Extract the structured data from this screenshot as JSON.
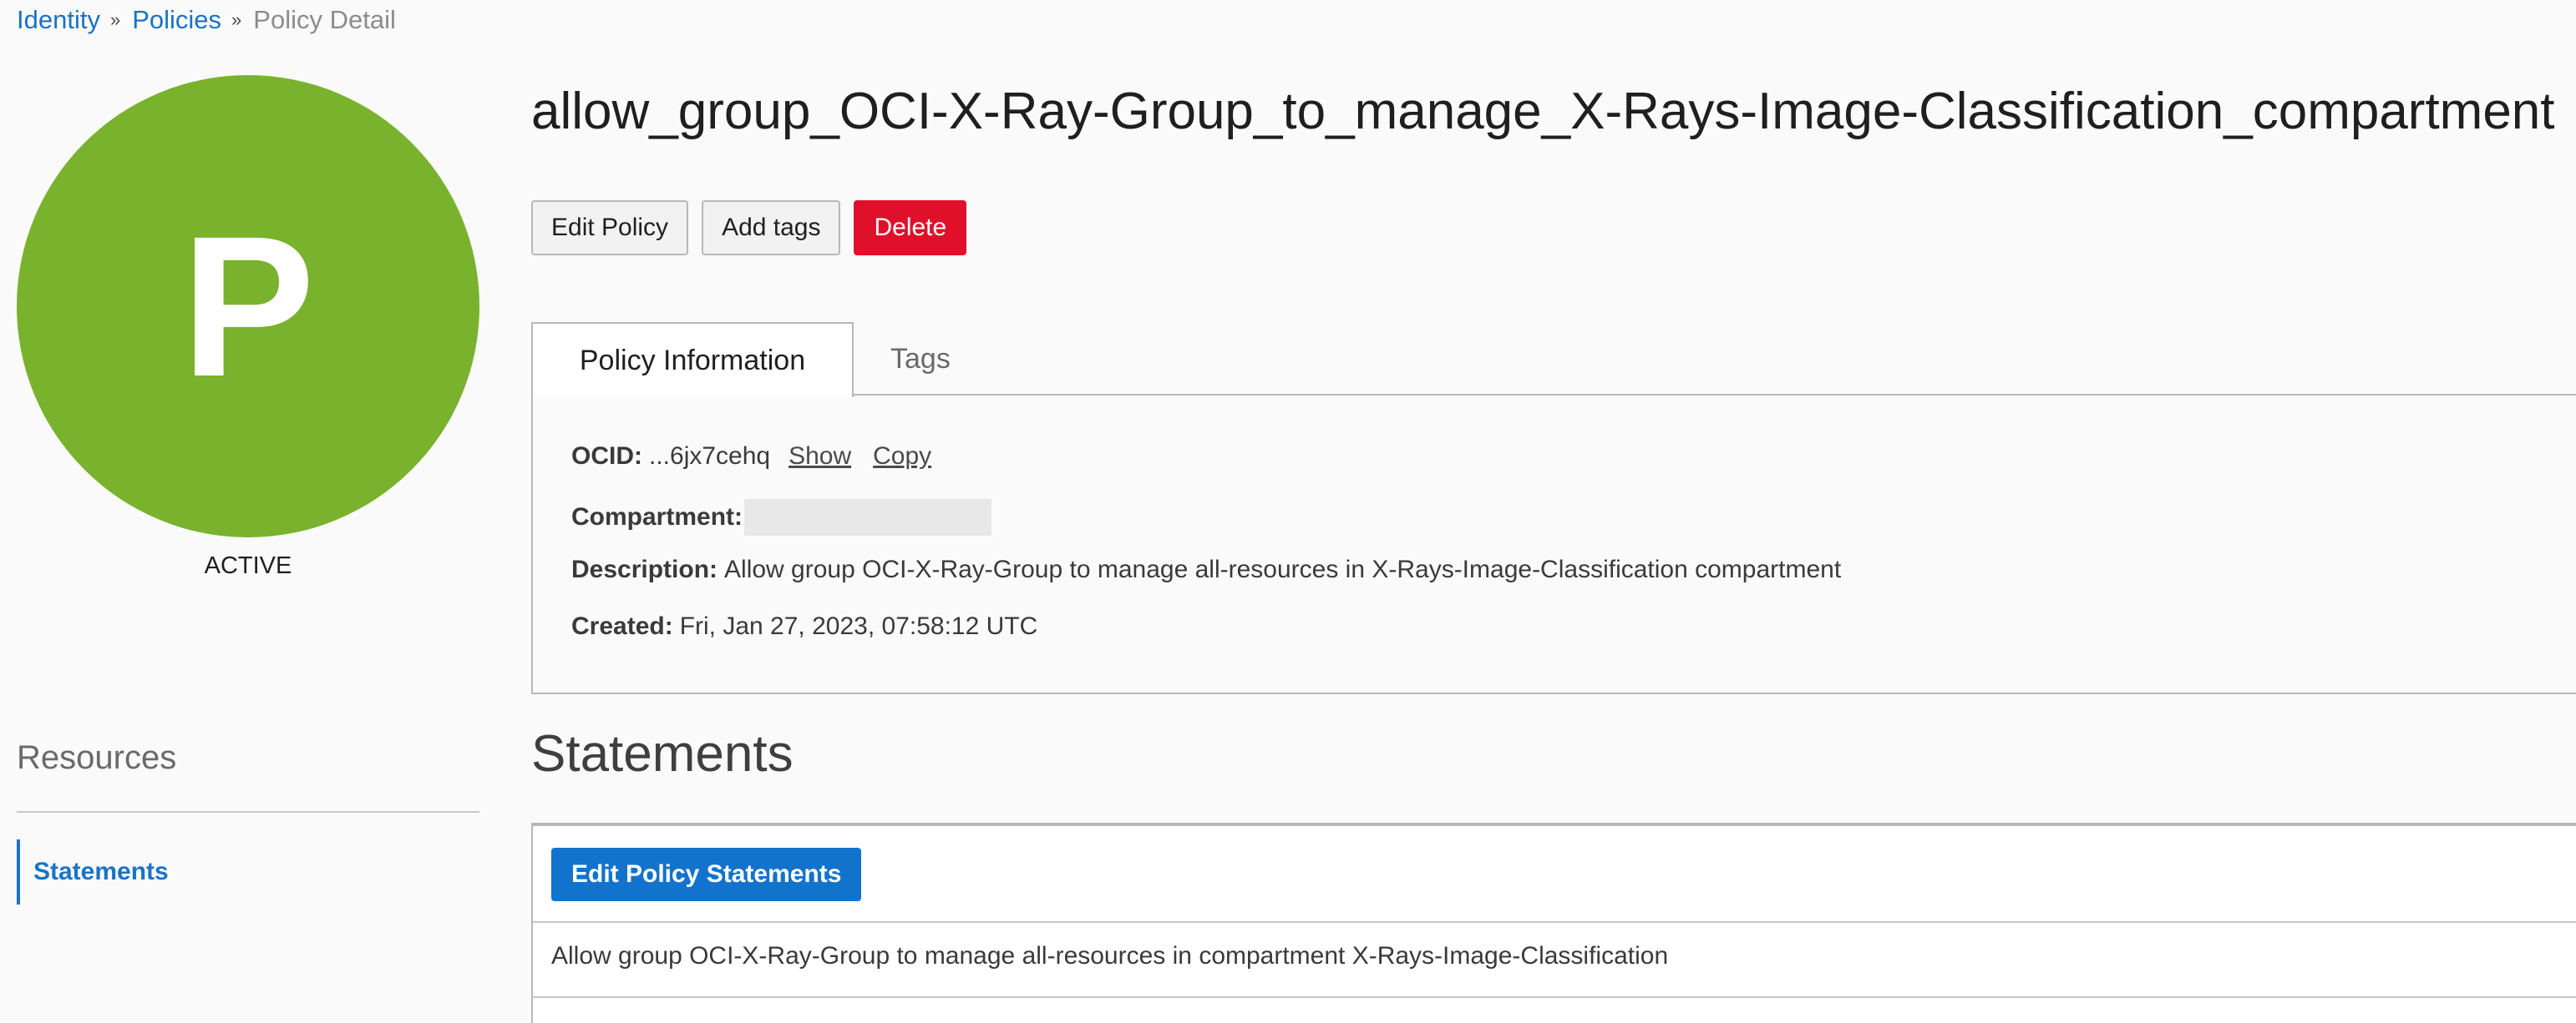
{
  "breadcrumb": {
    "items": [
      {
        "label": "Identity"
      },
      {
        "label": "Policies"
      }
    ],
    "current": "Policy Detail"
  },
  "avatar": {
    "letter": "P",
    "color": "#79b22d"
  },
  "status": "ACTIVE",
  "sidebar": {
    "heading": "Resources",
    "items": [
      {
        "label": "Statements",
        "active": true
      }
    ]
  },
  "title": "allow_group_OCI-X-Ray-Group_to_manage_X-Rays-Image-Classification_compartment",
  "actions": {
    "edit": "Edit Policy",
    "tags": "Add tags",
    "delete": "Delete"
  },
  "tabs": [
    {
      "label": "Policy Information",
      "active": true
    },
    {
      "label": "Tags",
      "active": false
    }
  ],
  "info": {
    "ocid_label": "OCID:",
    "ocid_value": "...6jx7cehq",
    "show": "Show",
    "copy": "Copy",
    "compartment_label": "Compartment:",
    "compartment_value": "",
    "description_label": "Description:",
    "description_value": "Allow group OCI-X-Ray-Group to manage all-resources in X-Rays-Image-Classification compartment",
    "created_label": "Created:",
    "created_value": "Fri, Jan 27, 2023, 07:58:12 UTC"
  },
  "statements": {
    "heading": "Statements",
    "edit_button": "Edit Policy Statements",
    "rows": [
      "Allow group OCI-X-Ray-Group to manage all-resources in compartment X-Rays-Image-Classification"
    ]
  },
  "colors": {
    "link": "#1a73c5",
    "delete": "#e0102a",
    "primary": "#1273cc"
  }
}
